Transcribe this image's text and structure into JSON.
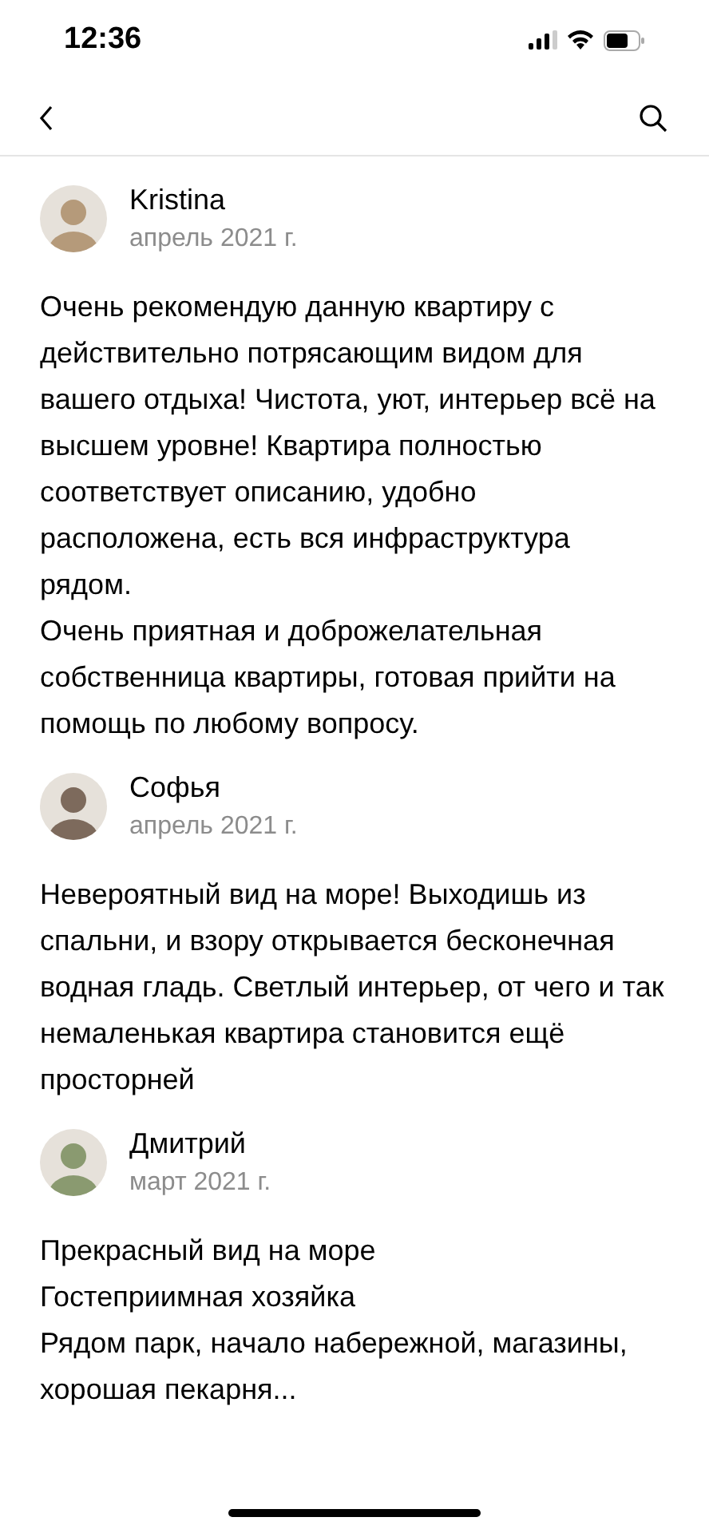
{
  "status_bar": {
    "time": "12:36"
  },
  "reviews": [
    {
      "author": "Kristina",
      "date": "апрель 2021 г.",
      "paragraphs": [
        "Очень рекомендую данную квартиру с действительно потрясающим видом для вашего отдыха! Чистота, уют, интерьер всё на высшем уровне! Квартира полностью соответствует описанию, удобно расположена, есть вся инфраструктура рядом.",
        "Очень приятная и доброжелательная собственница квартиры, готовая прийти на помощь по любому вопросу."
      ]
    },
    {
      "author": "Софья",
      "date": "апрель 2021 г.",
      "paragraphs": [
        "Невероятный вид на море! Выходишь из спальни, и взору открывается бесконечная водная гладь. Светлый интерьер, от чего и так немаленькая квартира становится ещё просторней"
      ]
    },
    {
      "author": "Дмитрий",
      "date": "март 2021 г.",
      "paragraphs": [
        "Прекрасный вид на море",
        "Гостеприимная хозяйка",
        "Рядом парк, начало набережной, магазины, хорошая пекарня..."
      ]
    }
  ]
}
